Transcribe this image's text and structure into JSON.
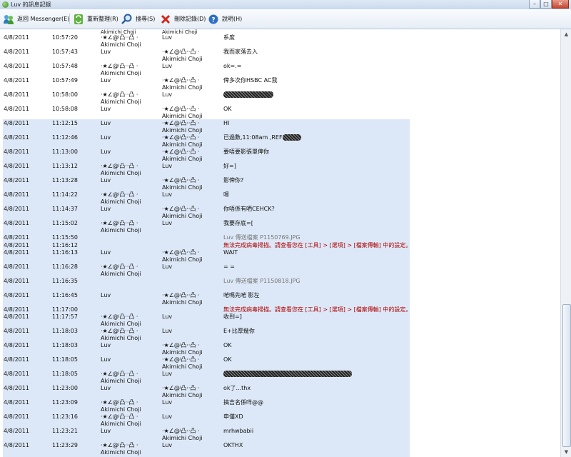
{
  "window": {
    "title": "Luv 的訊息記錄",
    "minimize": "–",
    "maximize": "□",
    "close": "✕"
  },
  "toolbar": {
    "back": "返回 Messenger(E)",
    "refresh": "重新整理(R)",
    "search": "搜尋(S)",
    "delete": "刪除記錄(D)",
    "help": "說明(H)"
  },
  "top_partial": {
    "from": "Akimichi Choji",
    "to": "Akimichi Choji"
  },
  "rows": [
    {
      "date": "4/8/2011",
      "time": "10:57:20",
      "from": [
        "·★∠@ʲ凸··凸 ·",
        "Akimichi Choji"
      ],
      "to": [
        "Luv"
      ],
      "msg": "系度"
    },
    {
      "date": "4/8/2011",
      "time": "10:57:43",
      "from": [
        "Luv"
      ],
      "to": [
        "·★∠@ʲ凸··凸 ·",
        "Akimichi Choji"
      ],
      "msg": "我而家落去入"
    },
    {
      "date": "4/8/2011",
      "time": "10:57:48",
      "from": [
        "·★∠@ʲ凸··凸 ·",
        "Akimichi Choji"
      ],
      "to": [
        "Luv"
      ],
      "msg": "ok=.="
    },
    {
      "date": "4/8/2011",
      "time": "10:57:49",
      "from": [
        "Luv"
      ],
      "to": [
        "·★∠@ʲ凸··凸 ·",
        "Akimichi Choji"
      ],
      "msg": "俾多次你HSBC AC我"
    },
    {
      "date": "4/8/2011",
      "time": "10:58:00",
      "from": [
        "·★∠@ʲ凸··凸 ·",
        "Akimichi Choji"
      ],
      "to": [
        "Luv"
      ],
      "msg": ""
    },
    {
      "date": "4/8/2011",
      "time": "10:58:08",
      "from": [
        "Luv"
      ],
      "to": [
        "·★∠@ʲ凸··凸 ·",
        "Akimichi Choji"
      ],
      "msg": "OK"
    },
    {
      "date": "4/8/2011",
      "time": "11:12:15",
      "from": [
        "Luv"
      ],
      "to": [
        "·★∠@ʲ凸··凸 ·",
        "Akimichi Choji"
      ],
      "msg": "HI"
    },
    {
      "date": "4/8/2011",
      "time": "11:12:46",
      "from": [
        "Luv"
      ],
      "to": [
        "·★∠@ʲ凸··凸 ·",
        "Akimichi Choji"
      ],
      "msg": "已過數,11:08am ,REF"
    },
    {
      "date": "4/8/2011",
      "time": "11:13:00",
      "from": [
        "Luv"
      ],
      "to": [
        "·★∠@ʲ凸··凸 ·",
        "Akimichi Choji"
      ],
      "msg": "要唔要影張單俾你"
    },
    {
      "date": "4/8/2011",
      "time": "11:13:12",
      "from": [
        "·★∠@ʲ凸··凸 ·",
        "Akimichi Choji"
      ],
      "to": [
        "Luv"
      ],
      "msg": "好=]"
    },
    {
      "date": "4/8/2011",
      "time": "11:13:28",
      "from": [
        "Luv"
      ],
      "to": [
        "·★∠@ʲ凸··凸 ·",
        "Akimichi Choji"
      ],
      "msg": "影俾你?"
    },
    {
      "date": "4/8/2011",
      "time": "11:14:22",
      "from": [
        "·★∠@ʲ凸··凸 ·",
        "Akimichi Choji"
      ],
      "to": [
        "Luv"
      ],
      "msg": "嗯"
    },
    {
      "date": "4/8/2011",
      "time": "11:14:37",
      "from": [
        "Luv"
      ],
      "to": [
        "·★∠@ʲ凸··凸 ·",
        "Akimichi Choji"
      ],
      "msg": "你唔係有哂CEHCK?"
    },
    {
      "date": "4/8/2011",
      "time": "11:15:02",
      "from": [
        "·★∠@ʲ凸··凸 ·",
        "Akimichi Choji"
      ],
      "to": [
        "Luv"
      ],
      "msg": "我要存底=["
    },
    {
      "date": "4/8/2011",
      "time": "11:15:50",
      "msg": "Luv 傳送檔案 P1150769.JPG",
      "kind": "file"
    },
    {
      "date": "4/8/2011",
      "time": "11:16:12",
      "msg": "無法完成病毒掃描。請查看您在 [工具] > [選項] > [檔案傳輸] 中的設定。",
      "kind": "warn"
    },
    {
      "date": "4/8/2011",
      "time": "11:16:13",
      "from": [
        "Luv"
      ],
      "to": [
        "·★∠@ʲ凸··凸 ·",
        "Akimichi Choji"
      ],
      "msg": "WAIT"
    },
    {
      "date": "4/8/2011",
      "time": "11:16:28",
      "from": [
        "·★∠@ʲ凸··凸 ·",
        "Akimichi Choji"
      ],
      "to": [
        "Luv"
      ],
      "msg": "= ="
    },
    {
      "date": "4/8/2011",
      "time": "11:16:35",
      "msg": "Luv 傳送檔案 P1150818.JPG",
      "kind": "file"
    },
    {
      "date": "4/8/2011",
      "time": "11:16:45",
      "from": [
        "Luv"
      ],
      "to": [
        "·★∠@ʲ凸··凸 ·",
        "Akimichi Choji"
      ],
      "msg": "啱嗎先啱 影左"
    },
    {
      "date": "4/8/2011",
      "time": "11:17:00",
      "msg": "無法完成病毒掃描。請查看您在 [工具] > [選項] > [檔案傳輸] 中的設定。",
      "kind": "warn"
    },
    {
      "date": "4/8/2011",
      "time": "11:17:57",
      "from": [
        "·★∠@ʲ凸··凸 ·",
        "Akimichi Choji"
      ],
      "to": [
        "Luv"
      ],
      "msg": "收到=]"
    },
    {
      "date": "4/8/2011",
      "time": "11:18:03",
      "from": [
        "·★∠@ʲ凸··凸 ·",
        "Akimichi Choji"
      ],
      "to": [
        "Luv"
      ],
      "msg": "E+比厚幾你"
    },
    {
      "date": "4/8/2011",
      "time": "11:18:03",
      "from": [
        "Luv"
      ],
      "to": [
        "·★∠@ʲ凸··凸 ·",
        "Akimichi Choji"
      ],
      "msg": "OK"
    },
    {
      "date": "4/8/2011",
      "time": "11:18:05",
      "from": [
        "Luv"
      ],
      "to": [
        "·★∠@ʲ凸··凸 ·",
        "Akimichi Choji"
      ],
      "msg": "OK"
    },
    {
      "date": "4/8/2011",
      "time": "11:18:05",
      "from": [
        "·★∠@ʲ凸··凸 ·",
        "Akimichi Choji"
      ],
      "to": [
        "Luv"
      ],
      "msg": ""
    },
    {
      "date": "4/8/2011",
      "time": "11:23:00",
      "from": [
        "Luv"
      ],
      "to": [
        "·★∠@ʲ凸··凸 ·",
        "Akimichi Choji"
      ],
      "msg": "ok了...thx"
    },
    {
      "date": "4/8/2011",
      "time": "11:23:09",
      "from": [
        "·★∠@ʲ凸··凸 ·",
        "Akimichi Choji"
      ],
      "to": [
        "Luv"
      ],
      "msg": "搞吉名係咩@@"
    },
    {
      "date": "4/8/2011",
      "time": "11:23:16",
      "from": [
        "·★∠@ʲ凸··凸 ·",
        "Akimichi Choji"
      ],
      "to": [
        "Luv"
      ],
      "msg": "申僅XD"
    },
    {
      "date": "4/8/2011",
      "time": "11:23:21",
      "from": [
        "Luv"
      ],
      "to": [
        "·★∠@ʲ凸··凸 ·",
        "Akimichi Choji"
      ],
      "msg": "mrhwbabii"
    },
    {
      "date": "4/8/2011",
      "time": "11:23:29",
      "from": [
        "·★∠@ʲ凸··凸 ·",
        "Akimichi Choji"
      ],
      "to": [
        "Luv"
      ],
      "msg": "OKTHX"
    }
  ]
}
